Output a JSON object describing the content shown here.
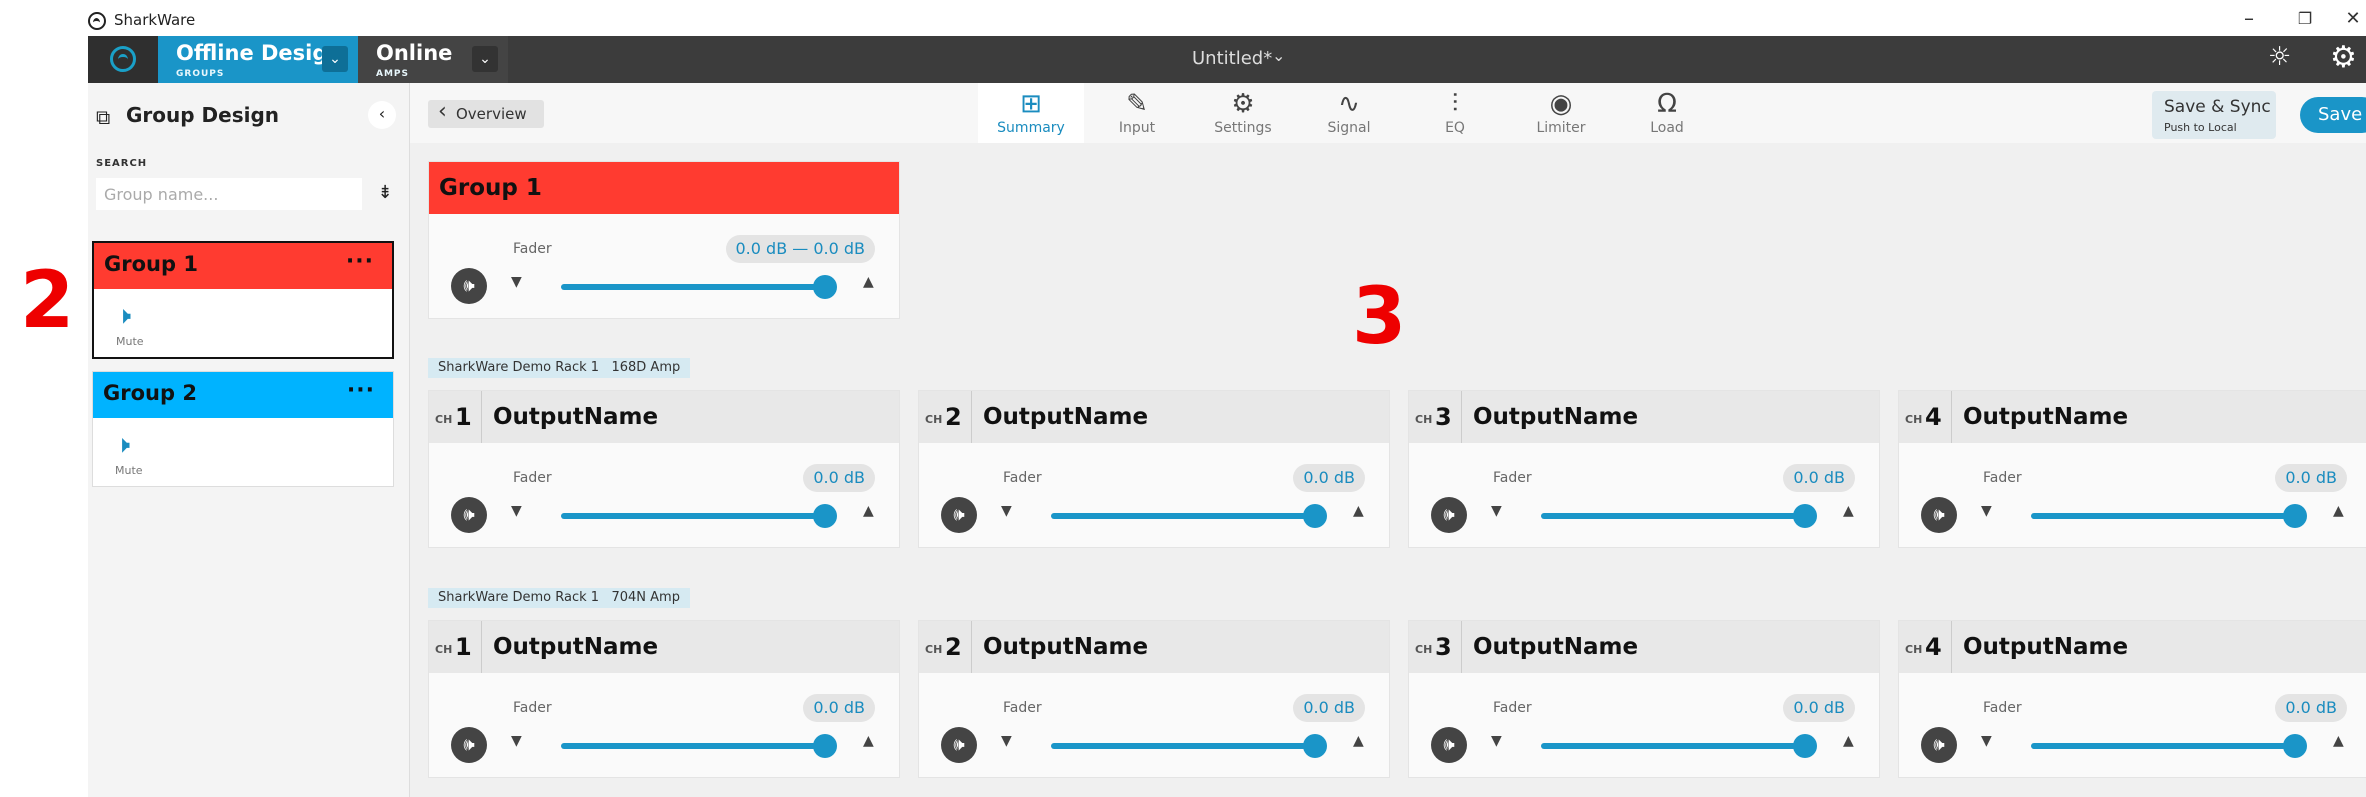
{
  "app": {
    "name": "SharkWare"
  },
  "window": {
    "minimize": "–",
    "restore": "❐",
    "close": "✕"
  },
  "topbar": {
    "offline": {
      "title": "Offline Design",
      "subtitle": "GROUPS"
    },
    "online": {
      "title": "Online",
      "subtitle": "AMPS"
    },
    "doc_title": "Untitled*",
    "doc_chevron": "⌄"
  },
  "sidebar": {
    "title": "Group Design",
    "collapse": "‹",
    "search_label": "SEARCH",
    "search_placeholder": "Group name...",
    "sort_icon": "⇟",
    "groups": [
      {
        "name": "Group 1",
        "menu": "···",
        "action": "Mute",
        "color": "#ff3b30",
        "selected": true
      },
      {
        "name": "Group 2",
        "menu": "···",
        "action": "Mute",
        "color": "#00b3ff",
        "selected": false
      }
    ]
  },
  "annotations": {
    "left": "2",
    "main": "3"
  },
  "toolbar": {
    "overview": "Overview",
    "tabs": [
      {
        "label": "Summary",
        "icon": "⊞",
        "active": true
      },
      {
        "label": "Input",
        "icon": "✎",
        "active": false
      },
      {
        "label": "Settings",
        "icon": "⚙",
        "active": false
      },
      {
        "label": "Signal",
        "icon": "∿",
        "active": false
      },
      {
        "label": "EQ",
        "icon": "⫶",
        "active": false
      },
      {
        "label": "Limiter",
        "icon": "◉",
        "active": false
      },
      {
        "label": "Load",
        "icon": "Ω",
        "active": false
      }
    ],
    "save_sync": {
      "title": "Save & Sync",
      "subtitle": "Push to Local"
    },
    "save": "Save"
  },
  "group_panel": {
    "title": "Group 1",
    "fader_label": "Fader",
    "value": "0.0 dB — 0.0 dB",
    "fader_level": 1.0
  },
  "racks": [
    {
      "rack": "SharkWare Demo Rack 1",
      "amp": "168D Amp",
      "channels": [
        {
          "ch_label": "CH",
          "num": "1",
          "name": "OutputName",
          "fader_label": "Fader",
          "value": "0.0 dB",
          "fader_level": 1.0
        },
        {
          "ch_label": "CH",
          "num": "2",
          "name": "OutputName",
          "fader_label": "Fader",
          "value": "0.0 dB",
          "fader_level": 1.0
        },
        {
          "ch_label": "CH",
          "num": "3",
          "name": "OutputName",
          "fader_label": "Fader",
          "value": "0.0 dB",
          "fader_level": 1.0
        },
        {
          "ch_label": "CH",
          "num": "4",
          "name": "OutputName",
          "fader_label": "Fader",
          "value": "0.0 dB",
          "fader_level": 1.0
        }
      ]
    },
    {
      "rack": "SharkWare Demo Rack 1",
      "amp": "704N Amp",
      "channels": [
        {
          "ch_label": "CH",
          "num": "1",
          "name": "OutputName",
          "fader_label": "Fader",
          "value": "0.0 dB",
          "fader_level": 1.0
        },
        {
          "ch_label": "CH",
          "num": "2",
          "name": "OutputName",
          "fader_label": "Fader",
          "value": "0.0 dB",
          "fader_level": 1.0
        },
        {
          "ch_label": "CH",
          "num": "3",
          "name": "OutputName",
          "fader_label": "Fader",
          "value": "0.0 dB",
          "fader_level": 1.0
        },
        {
          "ch_label": "CH",
          "num": "4",
          "name": "OutputName",
          "fader_label": "Fader",
          "value": "0.0 dB",
          "fader_level": 1.0
        }
      ]
    }
  ],
  "colors": {
    "accent": "#1a95c8",
    "offline_bg": "#1a95c8",
    "group1": "#ff3b30",
    "group2": "#00b3ff"
  }
}
